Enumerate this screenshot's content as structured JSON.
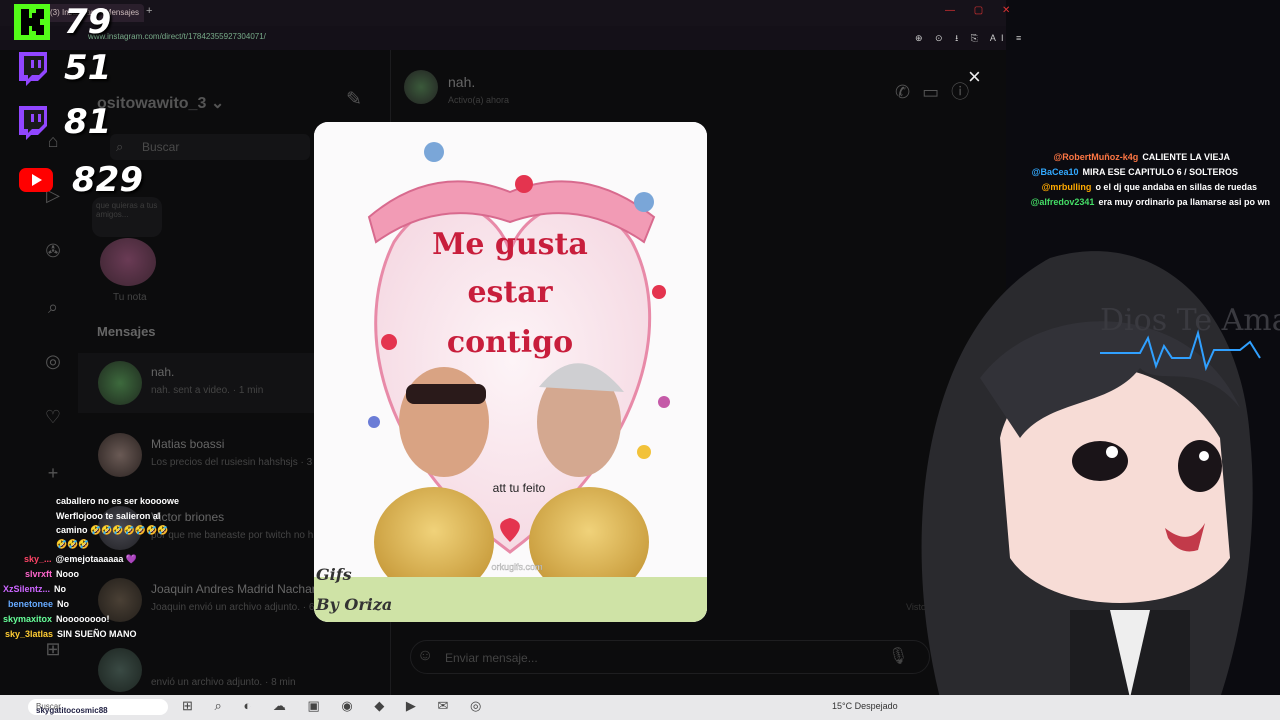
{
  "browser": {
    "tab_title": "(3) Instagram • Mensajes",
    "new_tab": "+",
    "url": "www.instagram.com/direct/t/17842355927304071/",
    "window_controls": "— ▢ ✕",
    "toolbar_icons": "⊕ ⊙ ⭳ ⎘ AI ≡"
  },
  "instagram": {
    "username": "ositowawito_3",
    "username_chevron": "⌄",
    "search_placeholder": "Buscar",
    "note_bubble_text": "que quieras a tus amigos...",
    "note_label": "Tu nota",
    "messages_heading": "Mensajes",
    "conversations": [
      {
        "name": "nah.",
        "preview": "nah. sent a video. · 1 min"
      },
      {
        "name": "Matias boassi",
        "preview": "Los precios del rusiesin hahshsjs · 3 h"
      },
      {
        "name": "Victor briones",
        "preview": "por que me baneaste por twitch no h"
      },
      {
        "name": "Joaquin Andres Madrid Nachar",
        "preview": "Joaquin envió un archivo adjunto. · 6 h"
      },
      {
        "name": "",
        "preview": "envió un archivo adjunto. · 8 min"
      }
    ],
    "chat": {
      "name": "nah.",
      "status": "Activo(a) ahora",
      "input_placeholder": "Enviar mensaje...",
      "seen": "Visto"
    },
    "close_label": "×"
  },
  "modal_image": {
    "title_line1": "Me gusta",
    "title_line2": "estar",
    "title_line3": "contigo",
    "caption": "att tu feito",
    "watermark": "orkugifs.com",
    "signature_line1": "Gifs",
    "signature_line2": "By Oriza"
  },
  "stream_stats": [
    {
      "platform": "kick",
      "value": "79",
      "color": "#53fc18"
    },
    {
      "platform": "twitch",
      "value": "51",
      "color": "#9146ff"
    },
    {
      "platform": "twitch",
      "value": "81",
      "color": "#9146ff"
    },
    {
      "platform": "youtube",
      "value": "829",
      "color": "#ff0000"
    }
  ],
  "side_chat": [
    {
      "user": "",
      "msg": "caballero no es ser koooowe",
      "color": "#ffffff"
    },
    {
      "user": "",
      "msg": "Werflojooo te salieron al",
      "color": "#ffffff"
    },
    {
      "user": "",
      "msg": "camino 🤣🤣🤣🤣🤣🤣🤣",
      "color": "#ffffff"
    },
    {
      "user": "",
      "msg": "🤣🤣🤣",
      "color": "#ffffff"
    },
    {
      "user": "sky_...",
      "msg": "@emejotaaaaaa 💜",
      "color": "#ff4466"
    },
    {
      "user": "slvrxft",
      "msg": "Nooo",
      "color": "#ff66cc"
    },
    {
      "user": "XzSilentz...",
      "msg": "No",
      "color": "#cc66ff"
    },
    {
      "user": "benetonee",
      "msg": "No",
      "color": "#66aaff"
    },
    {
      "user": "skymaxitox",
      "msg": "Noooooooo!",
      "color": "#66ff99"
    },
    {
      "user": "sky_3latlas",
      "msg": "SIN SUEÑO MANO",
      "color": "#ffcc33"
    }
  ],
  "top_chat": [
    {
      "user": "@RobertMuñoz-k4g",
      "msg": "CALIENTE LA VIEJA",
      "color": "#ff7744"
    },
    {
      "user": "@BaCea10",
      "msg": "MIRA ESE CAPITULO 6 / SOLTEROS",
      "color": "#33aaff"
    },
    {
      "user": "@mrbulling",
      "msg": "o el dj que andaba en sillas de ruedas",
      "color": "#ffaa00"
    },
    {
      "user": "@alfredov2341",
      "msg": "era muy ordinario pa llamarse asi po wn",
      "color": "#44dd66"
    }
  ],
  "vtuber": {
    "banner_text": "Dios Te Ama"
  },
  "taskbar": {
    "search": "Buscar",
    "bottom_user": "skygatitocosmic88",
    "icons": "⊞ ⌕ ◐ ☁ ▣ ◉ ◆ ▶ ✉ ◎",
    "weather": "15°C  Despejado"
  }
}
